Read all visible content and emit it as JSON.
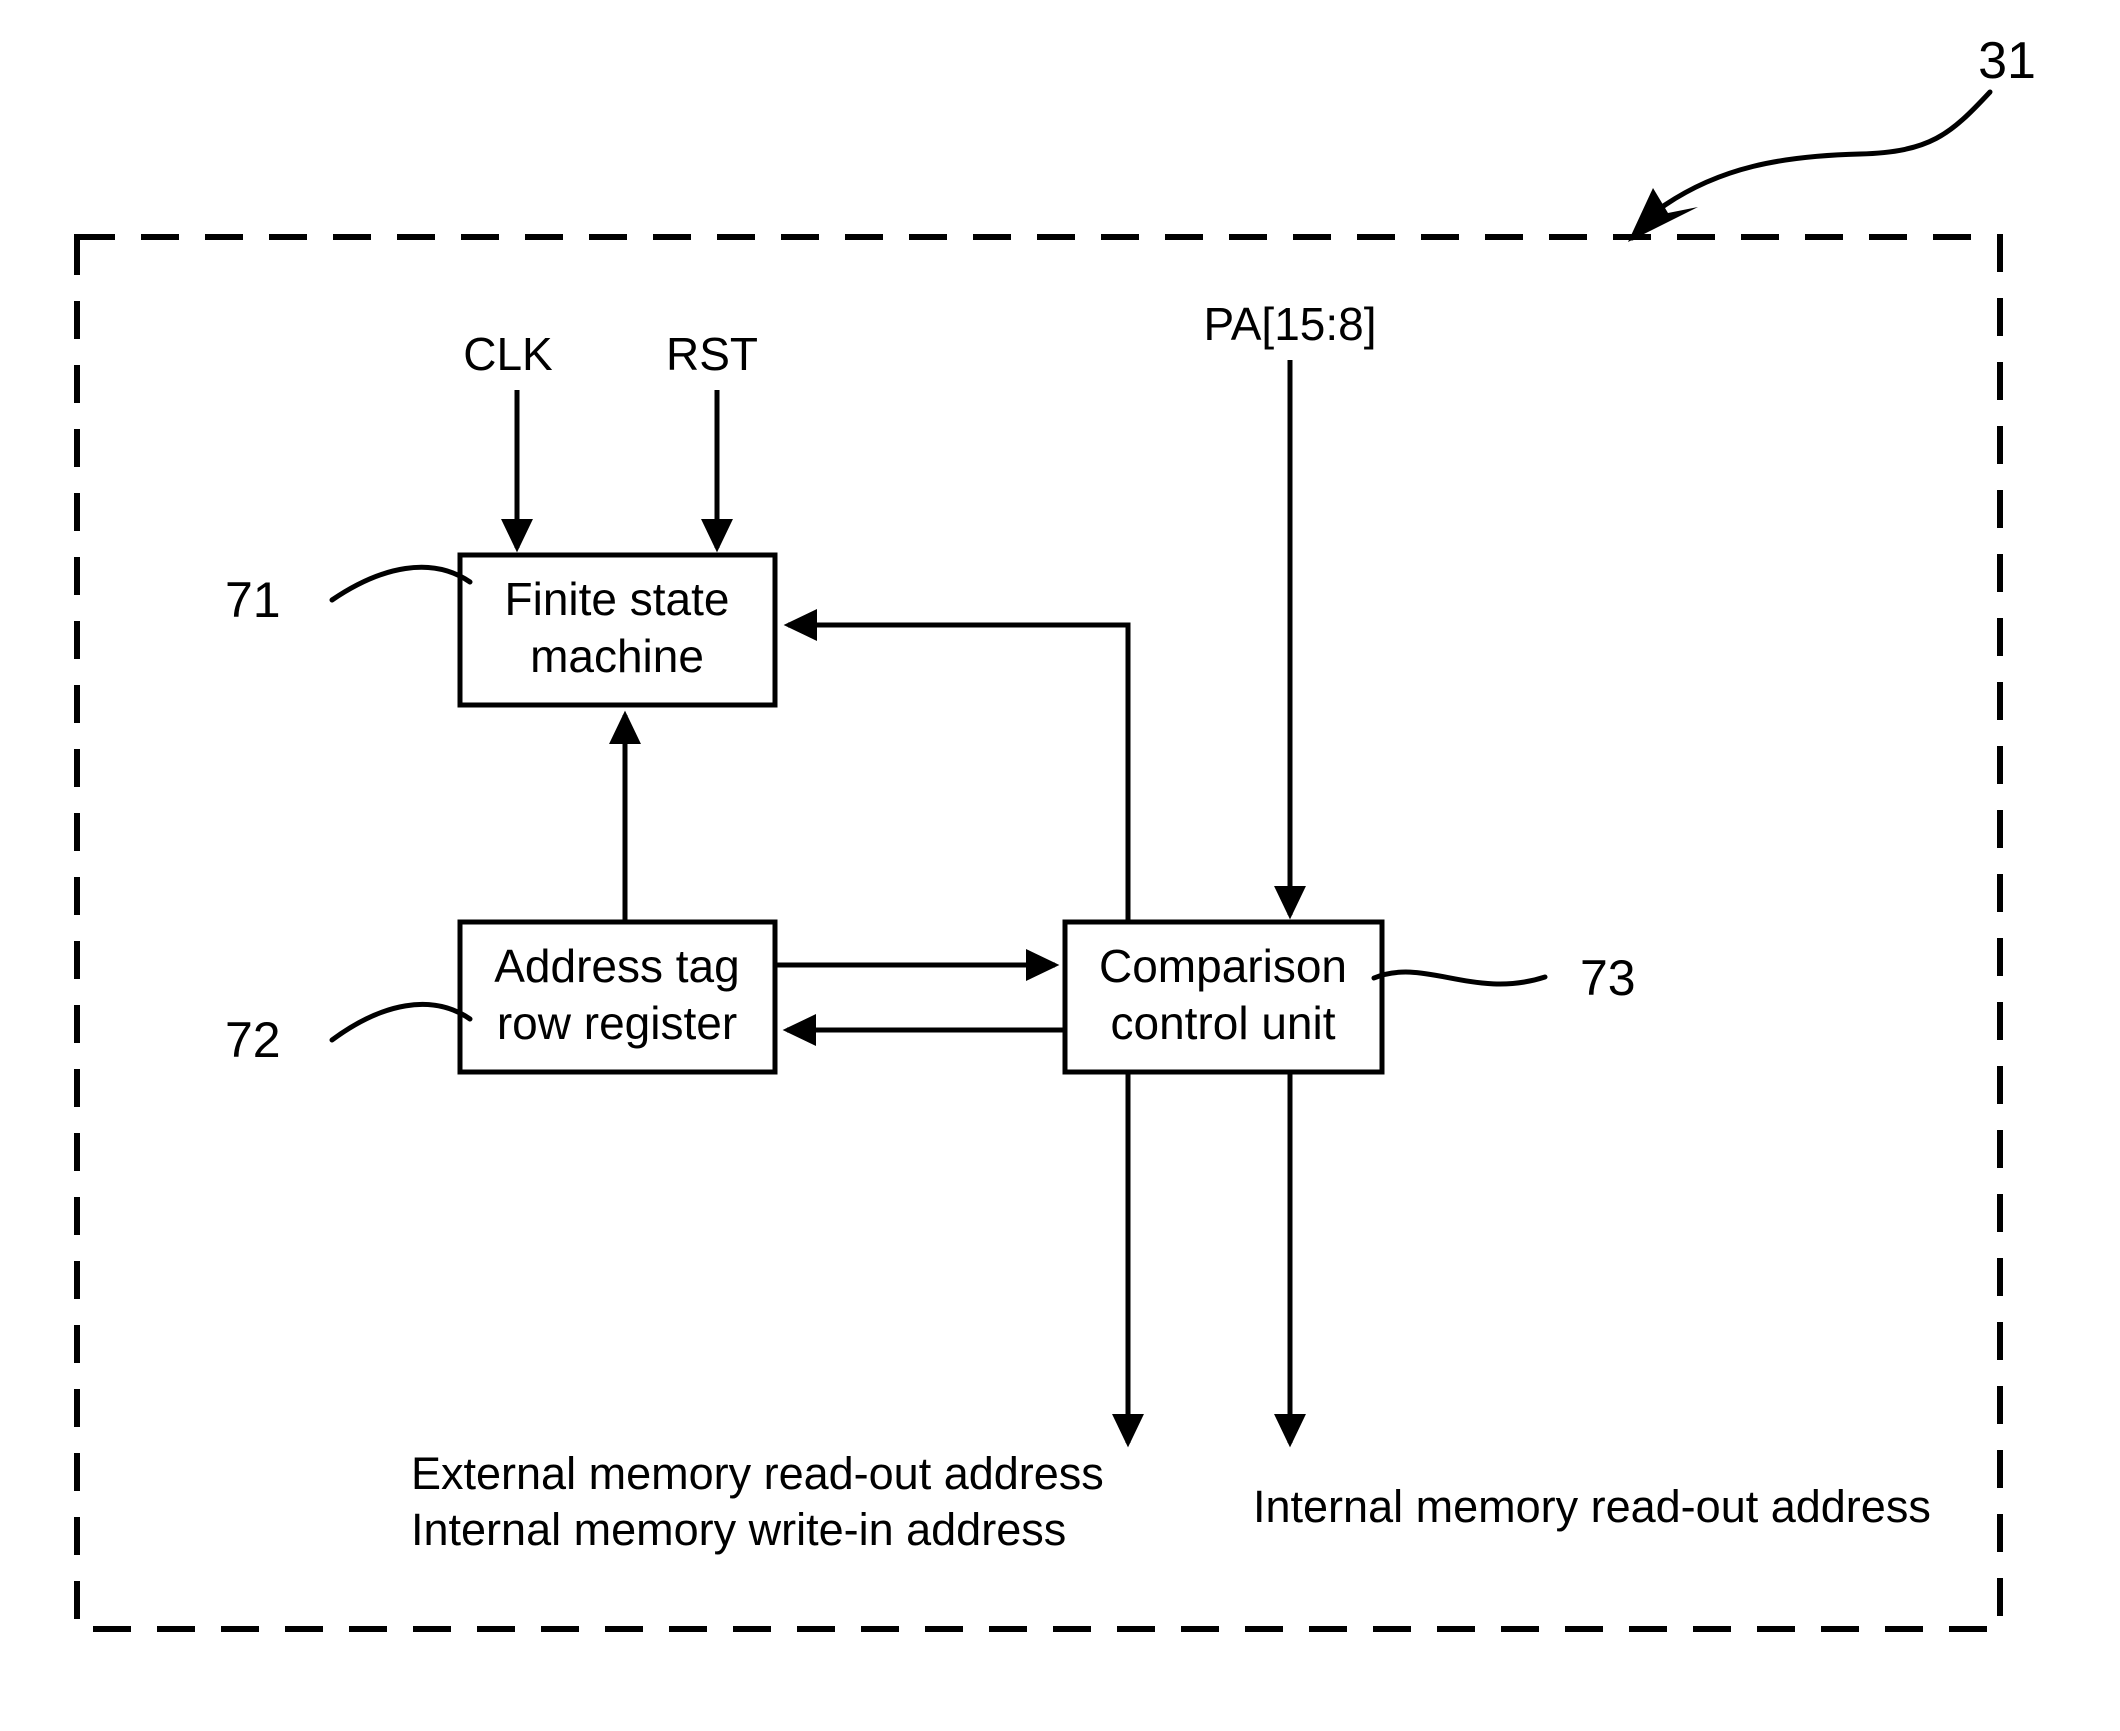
{
  "figure": {
    "reference_numeral": "31",
    "enclosure_style": "dashed"
  },
  "blocks": [
    {
      "id": "finite-state-machine",
      "line1": "Finite state",
      "line2": "machine",
      "reference_numeral": "71"
    },
    {
      "id": "address-tag-row-register",
      "line1": "Address tag",
      "line2": "row register",
      "reference_numeral": "72"
    },
    {
      "id": "comparison-control-unit",
      "line1": "Comparison",
      "line2": "control unit",
      "reference_numeral": "73"
    }
  ],
  "input_signals": [
    {
      "id": "clk",
      "label": "CLK"
    },
    {
      "id": "rst",
      "label": "RST"
    },
    {
      "id": "pa",
      "label": "PA[15:8]"
    }
  ],
  "output_labels": [
    {
      "id": "external-read-internal-write",
      "line1": "External memory read-out address",
      "line2": "Internal memory write-in address"
    },
    {
      "id": "internal-read",
      "line1": "Internal memory read-out address"
    }
  ],
  "colors": {
    "stroke": "#000000",
    "fill": "#ffffff",
    "background": "#ffffff"
  }
}
